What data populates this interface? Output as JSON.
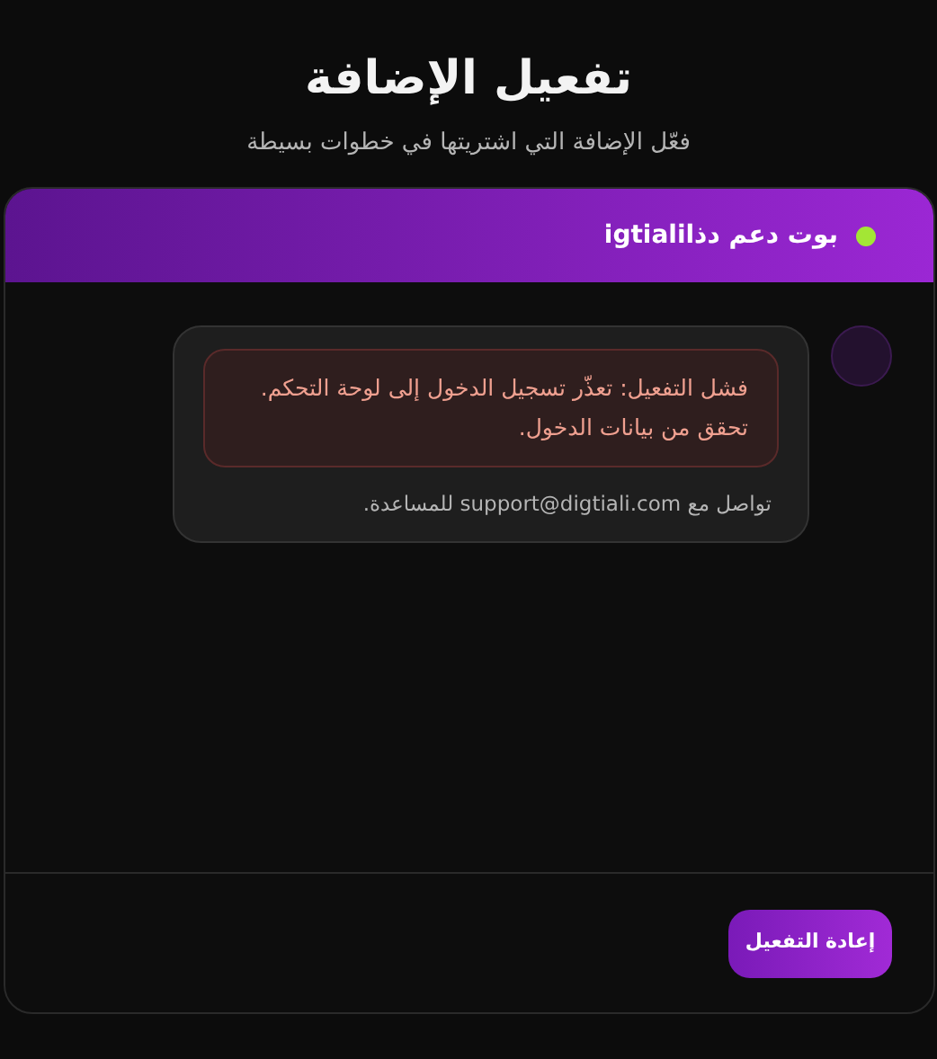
{
  "title": "تفعيل الإضافة",
  "subtitle": "فعّل الإضافة التي اشتريتها في خطوات بسيطة",
  "chat": {
    "bot_name": "بوت دعم دذاigtiali",
    "online": true,
    "messages": [
      {
        "error": "فشل التفعيل: تعذّر تسجيل الدخول إلى لوحة التحكم. تحقق من بيانات الدخول.",
        "note": "تواصل مع support@digtiali.com للمساعدة."
      }
    ]
  },
  "button": "إعادة التفعيل"
}
